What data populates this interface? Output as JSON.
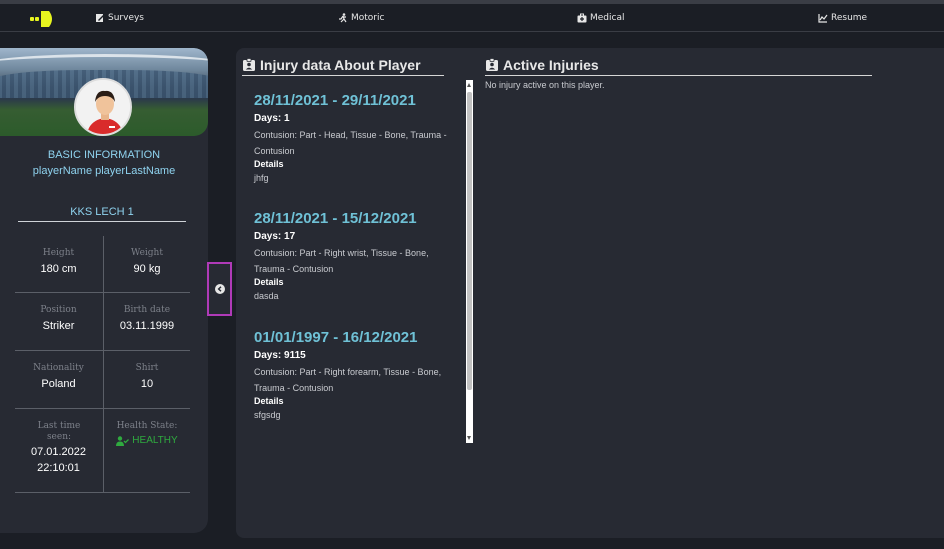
{
  "nav": {
    "logo_color": "#e8f51f",
    "items": [
      {
        "label": "Surveys",
        "icon": "survey-icon"
      },
      {
        "label": "Motoric",
        "icon": "running-icon"
      },
      {
        "label": "Medical",
        "icon": "medkit-icon"
      },
      {
        "label": "Resume",
        "icon": "chart-icon"
      }
    ]
  },
  "player": {
    "section_title": "BASIC INFORMATION",
    "name": "playerName playerLastName",
    "team": "KKS LECH 1",
    "stats": [
      {
        "label": "Height",
        "value": "180 cm"
      },
      {
        "label": "Weight",
        "value": "90 kg"
      },
      {
        "label": "Position",
        "value": "Striker"
      },
      {
        "label": "Birth date",
        "value": "03.11.1999"
      },
      {
        "label": "Nationality",
        "value": "Poland"
      },
      {
        "label": "Shirt",
        "value": "10"
      }
    ],
    "last_seen_label": "Last time seen:",
    "last_seen_date": "07.01.2022",
    "last_seen_time": "22:10:01",
    "health_label": "Health State:",
    "health_value": "HEALTHY",
    "health_color": "#2faa3f"
  },
  "injury_section": {
    "title": "Injury data About Player",
    "days_prefix": "Days: ",
    "details_label": "Details",
    "injuries": [
      {
        "range": "28/11/2021 - 29/11/2021",
        "days": "1",
        "description": "Contusion: Part - Head, Tissue - Bone, Trauma - Contusion",
        "details": "jhfg"
      },
      {
        "range": "28/11/2021 - 15/12/2021",
        "days": "17",
        "description": "Contusion: Part - Right wrist, Tissue - Bone, Trauma - Contusion",
        "details": "dasda"
      },
      {
        "range": "01/01/1997 - 16/12/2021",
        "days": "9115",
        "description": "Contusion: Part - Right forearm, Tissue - Bone, Trauma - Contusion",
        "details": "sfgsdg"
      }
    ]
  },
  "active_section": {
    "title": "Active Injuries",
    "empty_text": "No injury active on this player."
  },
  "colors": {
    "accent": "#6fc1d6",
    "toggle_border": "#b03ab8"
  }
}
